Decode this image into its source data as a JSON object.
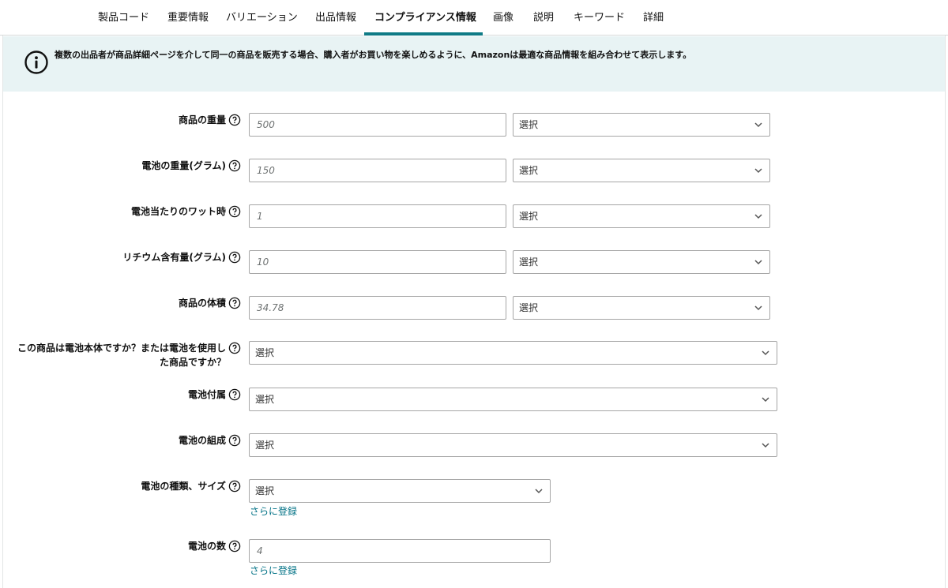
{
  "tabs": [
    "製品コード",
    "重要情報",
    "バリエーション",
    "出品情報",
    "コンプライアンス情報",
    "画像",
    "説明",
    "キーワード",
    "詳細"
  ],
  "active_tab": "コンプライアンス情報",
  "notice": {
    "icon": "info-icon",
    "text": "複数の出品者が商品詳細ページを介して同一の商品を販売する場合、購入者がお買い物を楽しめるように、Amazonは最適な商品情報を組み合わせて表示します。"
  },
  "fields": {
    "item_weight": {
      "label": "商品の重量",
      "value": "500",
      "unit": "選択"
    },
    "battery_weight": {
      "label": "電池の重量(グラム)",
      "value": "150",
      "unit": "選択"
    },
    "watt_hours": {
      "label": "電池当たりのワット時",
      "value": "1",
      "unit": "選択"
    },
    "lithium_content": {
      "label": "リチウム含有量(グラム)",
      "value": "10",
      "unit": "選択"
    },
    "item_volume": {
      "label": "商品の体積",
      "value": "34.78",
      "unit": "選択"
    },
    "is_battery": {
      "label_line1": "この商品は電池本体ですか？または電池を使用し",
      "label_line2": "た商品ですか？",
      "value": "選択"
    },
    "battery_included": {
      "label": "電池付属",
      "value": "選択"
    },
    "battery_composition": {
      "label": "電池の組成",
      "value": "選択"
    },
    "battery_type": {
      "label": "電池の種類、サイズ",
      "value": "選択",
      "more_link": "さらに登録"
    },
    "battery_count": {
      "label": "電池の数",
      "value": "4",
      "more_link": "さらに登録"
    }
  },
  "colors": {
    "accent": "#0f7b86",
    "notice_bg": "#e8f3f4",
    "link": "#007185"
  }
}
